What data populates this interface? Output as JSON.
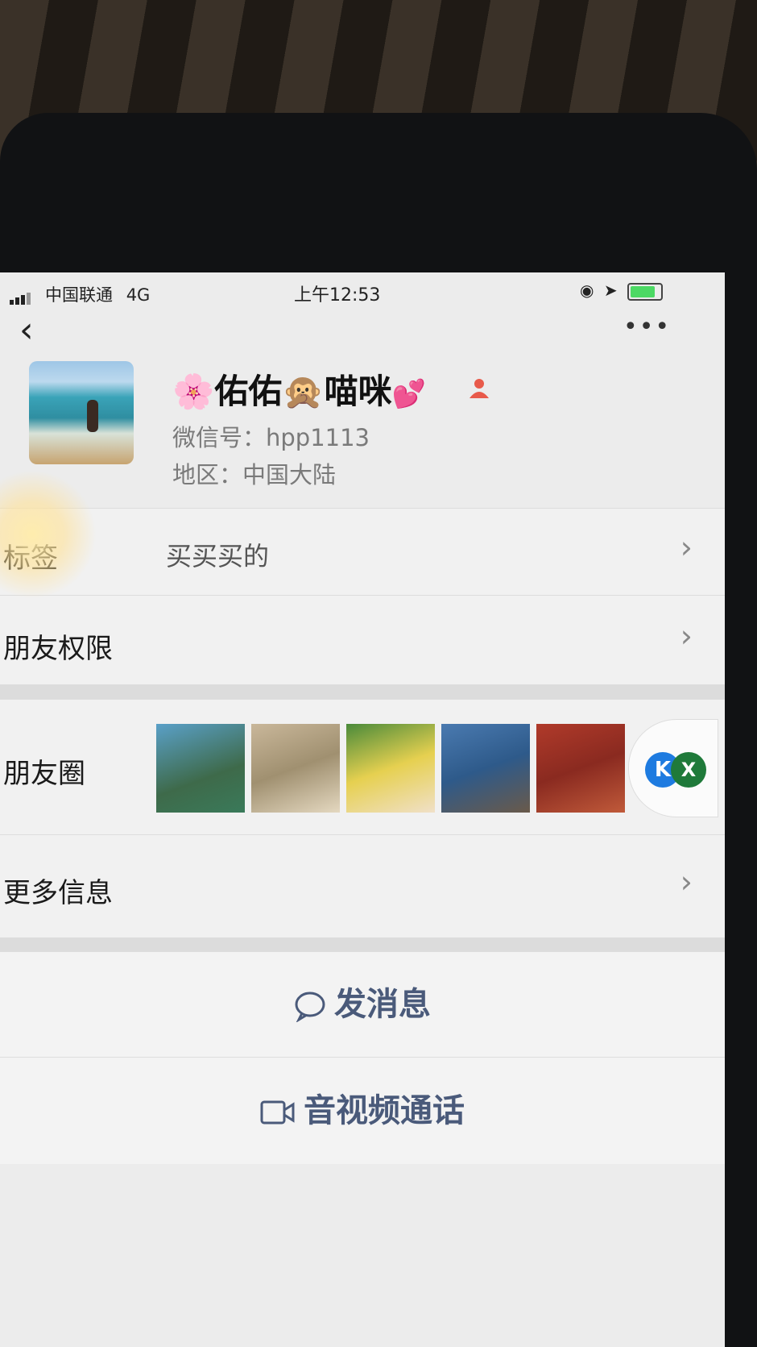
{
  "status_bar": {
    "carrier": "中国联通",
    "network": "4G",
    "time": "上午12:53"
  },
  "profile": {
    "nickname_flower": "🌸",
    "nickname_part1": "佑佑",
    "nickname_monkey": "🙊",
    "nickname_part2": "喵咪",
    "nickname_heart": "💕",
    "wechat_id": "微信号：hpp1113",
    "region": "地区：中国大陆"
  },
  "rows": {
    "tag_label": "标签",
    "tag_value": "买买买的",
    "permissions_label": "朋友权限",
    "moments_label": "朋友圈",
    "more_info_label": "更多信息",
    "chevron": "›"
  },
  "moments_badges": {
    "b1": "K",
    "b2": "X"
  },
  "actions": {
    "send_message": "发消息",
    "video_call": "音视频通话"
  },
  "icons": {
    "back": "chevron-left-icon",
    "more": "more-dots-icon",
    "person": "person-icon",
    "chat": "chat-bubble-icon",
    "video": "video-camera-icon"
  },
  "colors": {
    "action_text": "#4a5a7a",
    "person_icon": "#e85a4a"
  }
}
